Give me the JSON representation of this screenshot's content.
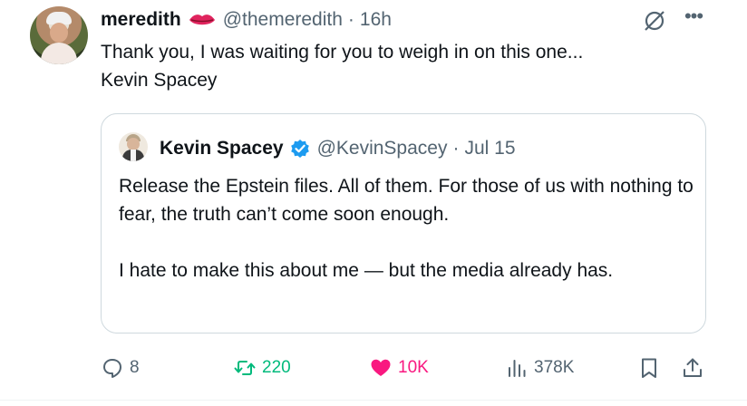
{
  "post": {
    "author": {
      "display_name": "meredith",
      "emoji_icon": "lips-icon",
      "handle": "@themeredith",
      "separator": "·",
      "time": "16h"
    },
    "text": "Thank you, I was waiting for you to weigh in on this one...\nKevin Spacey",
    "icons": {
      "grok": "grok-icon",
      "more": "more-icon"
    }
  },
  "quote": {
    "author": {
      "display_name": "Kevin Spacey",
      "verified": "verified-icon",
      "handle": "@KevinSpacey",
      "separator": "·",
      "date": "Jul 15"
    },
    "paragraphs": [
      "Release the Epstein files. All of them. For those of us with nothing to fear, the truth can’t come soon enough.",
      "I hate to make this about me — but the media already has."
    ]
  },
  "actions": {
    "replies": "8",
    "reposts": "220",
    "likes": "10K",
    "views": "378K"
  },
  "colors": {
    "repost": "#00ba7c",
    "like": "#f91880",
    "verified": "#1d9bf0",
    "muted": "#536471"
  }
}
